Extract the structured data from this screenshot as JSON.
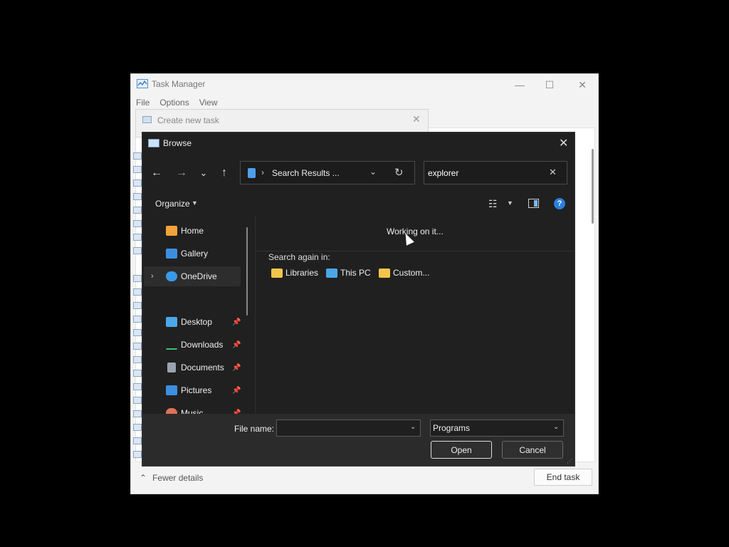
{
  "task_manager": {
    "title": "Task Manager",
    "menu": [
      "File",
      "Options",
      "View"
    ],
    "window_controls": {
      "minimize": "—",
      "maximize": "☐",
      "close": "✕"
    },
    "fewer_details": "Fewer details",
    "end_task": "End task"
  },
  "create_new_task": {
    "title": "Create new task",
    "close": "✕"
  },
  "browse": {
    "title": "Browse",
    "close": "✕",
    "nav": {
      "back": "←",
      "forward": "→",
      "recent": "⌄",
      "up": "↑"
    },
    "address": {
      "chevron": "›",
      "text": "Search Results ...",
      "dropdown": "⌄",
      "refresh": "↻"
    },
    "search": {
      "value": "explorer",
      "clear": "✕"
    },
    "toolbar": {
      "organize": "Organize",
      "caret": "▼",
      "view": "☷",
      "help": "?"
    },
    "nav_pane": [
      {
        "label": "Home",
        "icon": "home-icon",
        "color": "#f2a33a"
      },
      {
        "label": "Gallery",
        "icon": "gallery-icon",
        "color": "#3b8fe0"
      },
      {
        "label": "OneDrive",
        "icon": "onedrive-icon",
        "color": "#3a9ae8",
        "chevron": "›",
        "selected": true
      },
      {
        "label": "Desktop",
        "icon": "desktop-icon",
        "color": "#4aa7e8",
        "pinned": true
      },
      {
        "label": "Downloads",
        "icon": "download-icon",
        "color": "#3fbf6f",
        "pinned": true
      },
      {
        "label": "Documents",
        "icon": "documents-icon",
        "color": "#9aa4b1",
        "pinned": true
      },
      {
        "label": "Pictures",
        "icon": "pictures-icon",
        "color": "#3b8fe0",
        "pinned": true
      },
      {
        "label": "Music",
        "icon": "music-icon",
        "color": "#e07058",
        "pinned": true
      }
    ],
    "pin_glyph": "📌",
    "results": {
      "working": "Working on it...",
      "search_again": "Search again in:",
      "locations": [
        {
          "label": "Libraries",
          "icon": "libraries-icon",
          "color": "#f4c54a"
        },
        {
          "label": "This PC",
          "icon": "this-pc-icon",
          "color": "#4aa7e8"
        },
        {
          "label": "Custom...",
          "icon": "custom-folder-icon",
          "color": "#f4c54a"
        }
      ]
    },
    "bottom": {
      "file_name_label": "File name:",
      "file_name_value": "",
      "file_type": "Programs",
      "dropdown": "⌄",
      "open": "Open",
      "cancel": "Cancel",
      "grip": "⋰"
    }
  }
}
